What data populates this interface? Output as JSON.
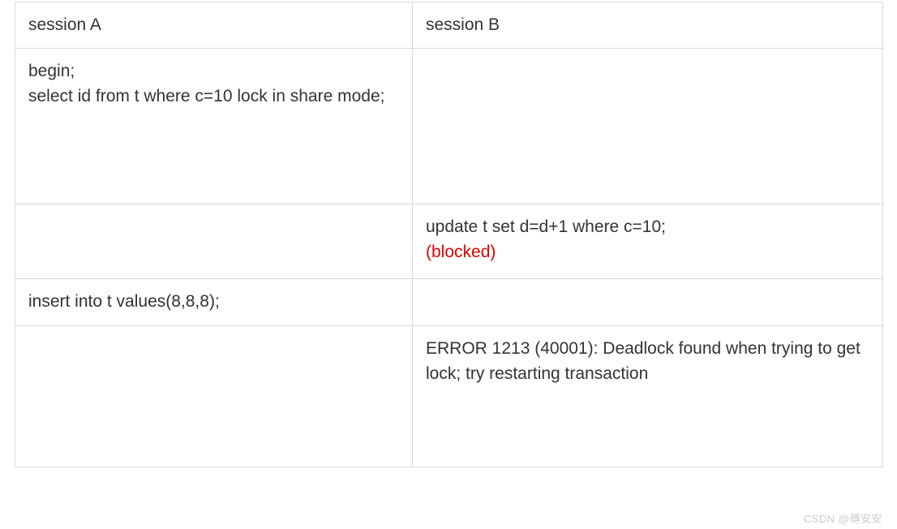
{
  "table": {
    "headers": {
      "col_a": "session A",
      "col_b": "session B"
    },
    "rows": {
      "r1": {
        "a_line1": "begin;",
        "a_line2": "select id from t where c=10 lock in share mode;",
        "b": ""
      },
      "r2": {
        "a": "",
        "b_line1": "update t set d=d+1 where c=10;",
        "b_blocked": "(blocked)"
      },
      "r3": {
        "a": "insert into t values(8,8,8);",
        "b": ""
      },
      "r4": {
        "a": "",
        "b": "ERROR 1213 (40001): Deadlock found when trying to get lock; try restarting transaction"
      }
    }
  },
  "watermark": "CSDN @傅安安"
}
